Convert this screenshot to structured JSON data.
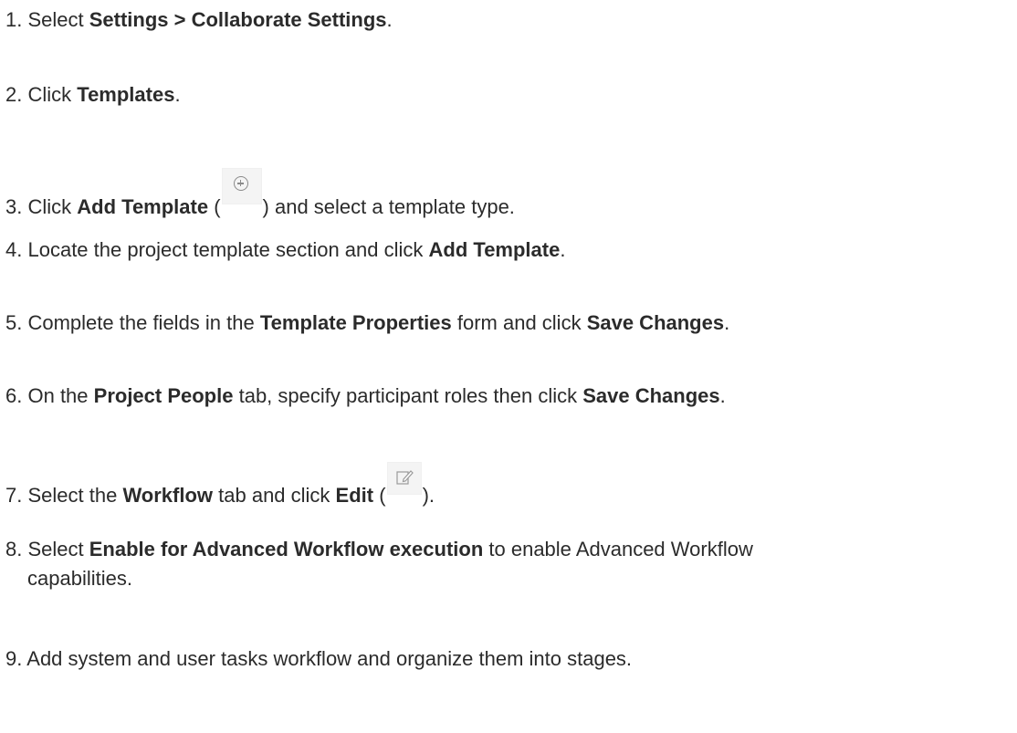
{
  "steps": [
    {
      "num": "1.",
      "parts": [
        "Select ",
        "Settings > Collaborate Settings",
        "."
      ]
    },
    {
      "num": "2.",
      "parts": [
        "Click ",
        "Templates",
        "."
      ]
    },
    {
      "num": "3.",
      "parts": [
        "Click ",
        "Add Template",
        " (",
        ") and select a template type."
      ]
    },
    {
      "num": "4.",
      "parts": [
        "Locate the project template section and click ",
        "Add Template",
        "."
      ]
    },
    {
      "num": "5.",
      "parts": [
        "Complete the fields in the ",
        "Template Properties",
        " form and click ",
        "Save Changes",
        "."
      ]
    },
    {
      "num": "6.",
      "parts": [
        "On the ",
        "Project People",
        " tab, specify participant roles then click ",
        "Save Changes",
        "."
      ]
    },
    {
      "num": "7.",
      "parts": [
        "Select the ",
        "Workflow",
        " tab and click ",
        "Edit",
        " (",
        ")."
      ]
    },
    {
      "num": "8.",
      "parts": [
        "Select ",
        "Enable for Advanced Workflow execution",
        " to enable Advanced Workflow",
        "capabilities."
      ]
    },
    {
      "num": "9.",
      "parts": [
        "Add system and user tasks workflow and organize them into stages."
      ]
    }
  ],
  "icons": {
    "add_template": "add-circle-icon",
    "edit": "edit-pencil-icon"
  }
}
